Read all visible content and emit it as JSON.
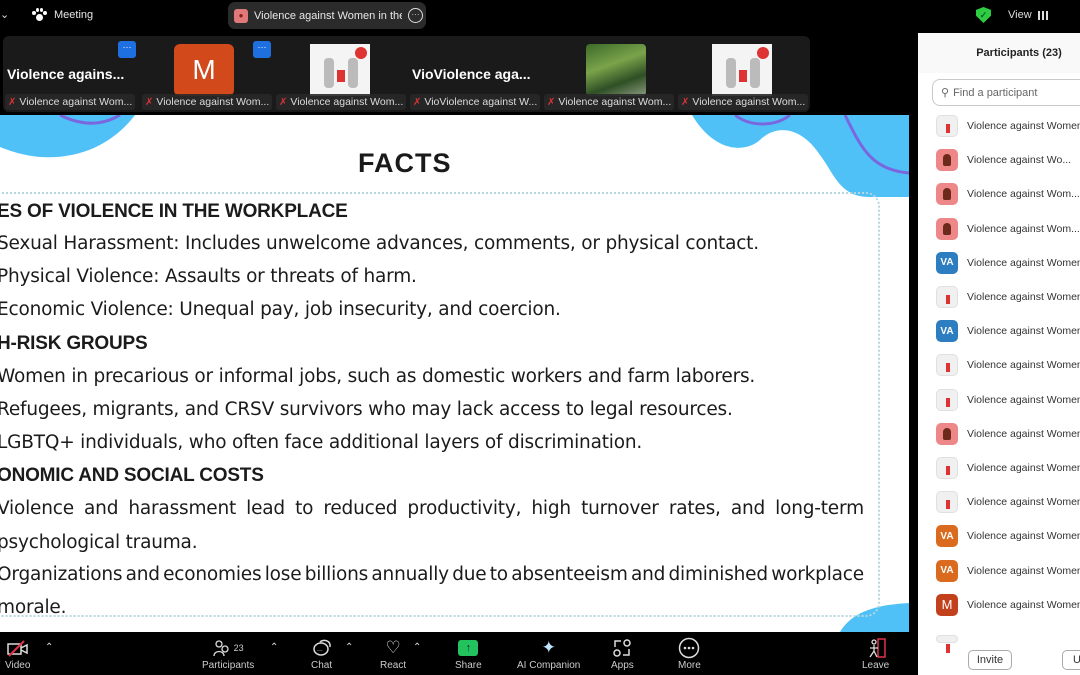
{
  "topbar": {
    "meeting_label": "Meeting",
    "active_tab_title": "Violence against Women in the W",
    "view_label": "View",
    "security_status_color": "#2ecc40"
  },
  "video_strip": {
    "tiles": [
      {
        "display": "name",
        "big_name": "Violence agains...",
        "label": "Violence against Wom...",
        "has_more_button": true
      },
      {
        "display": "avatar",
        "avatar_letter": "M",
        "avatar_color": "#d2491c",
        "label": "Violence against Wom...",
        "has_more_button": true
      },
      {
        "display": "picture",
        "picture": "stop-violence-poster",
        "label": "Violence against Wom..."
      },
      {
        "display": "name",
        "big_name": "VioViolence aga...",
        "label": "VioViolence against W..."
      },
      {
        "display": "picture",
        "picture": "forest-photo",
        "label": "Violence against Wom..."
      },
      {
        "display": "picture",
        "picture": "stop-violence-poster",
        "label": "Violence against Wom..."
      }
    ]
  },
  "slide": {
    "title": "FACTS",
    "lines": [
      {
        "type": "heading",
        "text": "ES OF VIOLENCE IN THE WORKPLACE"
      },
      {
        "type": "text",
        "text": "Sexual Harassment: Includes unwelcome advances, comments, or physical contact."
      },
      {
        "type": "text",
        "text": "Physical Violence: Assaults or threats of harm."
      },
      {
        "type": "text",
        "text": "Economic Violence: Unequal pay, job insecurity, and coercion."
      },
      {
        "type": "heading",
        "text": "H-RISK GROUPS"
      },
      {
        "type": "text",
        "text": "Women in precarious or informal jobs, such as domestic workers and farm laborers."
      },
      {
        "type": "text",
        "text": "Refugees, migrants, and CRSV survivors who may lack access to legal resources."
      },
      {
        "type": "text",
        "text": "LGBTQ+ individuals, who often face additional layers of discrimination."
      },
      {
        "type": "heading",
        "text": "ONOMIC AND SOCIAL COSTS"
      },
      {
        "type": "justified",
        "words": [
          "Violence",
          "and",
          "harassment",
          "lead",
          "to",
          "reduced",
          "productivity,",
          "high",
          "turnover",
          "rates,",
          "and",
          "long-term"
        ]
      },
      {
        "type": "text",
        "text": "psychological trauma."
      },
      {
        "type": "justified",
        "words": [
          "Organizations",
          "and",
          "economies",
          "lose",
          "billions",
          "annually",
          "due",
          "to",
          "absenteeism",
          "and",
          "diminished",
          "workplace"
        ]
      },
      {
        "type": "text",
        "text": "morale."
      }
    ],
    "accent_color": "#4fc1f7",
    "wave_line_color": "#7a67e0"
  },
  "participants_panel": {
    "title": "Participants (23)",
    "search_placeholder": "Find a participant",
    "participants": [
      {
        "name": "Violence against Women",
        "avatar": "pic1"
      },
      {
        "name": "Violence against Wo...",
        "avatar": "pic2"
      },
      {
        "name": "Violence against Wom...",
        "avatar": "pic2"
      },
      {
        "name": "Violence against Wom...",
        "avatar": "pic2"
      },
      {
        "name": "Violence against Women",
        "avatar": "va-blue",
        "initials": "VA"
      },
      {
        "name": "Violence against Women",
        "avatar": "pic1"
      },
      {
        "name": "Violence against Women",
        "avatar": "va-blue",
        "initials": "VA"
      },
      {
        "name": "Violence against Women",
        "avatar": "pic1"
      },
      {
        "name": "Violence against Women",
        "avatar": "pic1"
      },
      {
        "name": "Violence against Women",
        "avatar": "pic2"
      },
      {
        "name": "Violence against Women",
        "avatar": "pic1"
      },
      {
        "name": "Violence against Women",
        "avatar": "pic1"
      },
      {
        "name": "Violence against Women",
        "avatar": "va-orange",
        "initials": "VA"
      },
      {
        "name": "Violence against Women",
        "avatar": "va-orange",
        "initials": "VA"
      },
      {
        "name": "Violence against Women",
        "avatar": "m-red",
        "initials": "M"
      }
    ],
    "invite_label": "Invite",
    "second_button_label": "U"
  },
  "toolbar": {
    "video_label": "Video",
    "participants_label": "Participants",
    "participants_count": "23",
    "chat_label": "Chat",
    "react_label": "React",
    "share_label": "Share",
    "ai_label": "AI Companion",
    "apps_label": "Apps",
    "more_label": "More",
    "leave_label": "Leave"
  }
}
